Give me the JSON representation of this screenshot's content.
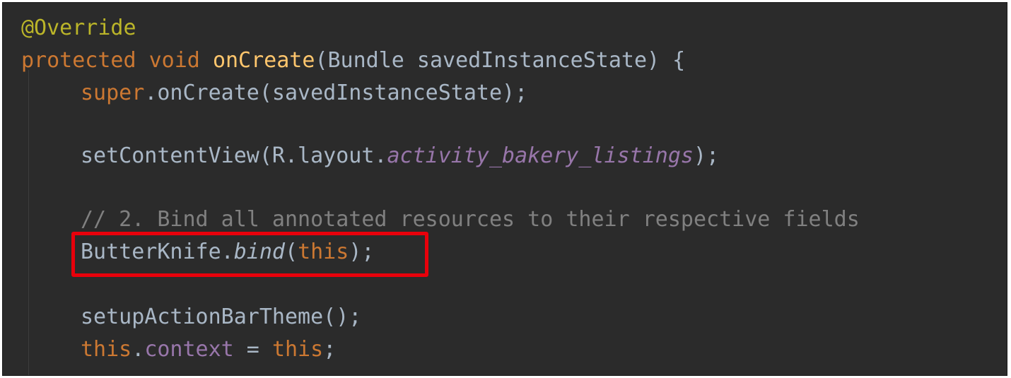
{
  "colors": {
    "background": "#2b2b2b",
    "plain": "#a9b7c6",
    "keyword": "#cc7832",
    "method_decl": "#ffc66d",
    "annotation": "#bbb529",
    "static_field": "#9876aa",
    "comment": "#808080",
    "highlight_border": "#e8000b"
  },
  "code": {
    "l1": {
      "annotation": "@Override"
    },
    "l2": {
      "kw_protected": "protected",
      "kw_void": "void",
      "method": "onCreate",
      "params": "(Bundle savedInstanceState) {"
    },
    "l3": {
      "kw_super": "super",
      "rest": ".onCreate(savedInstanceState);"
    },
    "l4": {
      "pre": "setContentView(R.layout.",
      "static_field": "activity_bakery_listings",
      "post": ");"
    },
    "l5": {
      "comment": "// 2. Bind all annotated resources to their respective fields"
    },
    "l6": {
      "pre": "ButterKnife.",
      "method_italic": "bind",
      "open": "(",
      "kw_this": "this",
      "close": ");"
    },
    "l7": {
      "text": "setupActionBarTheme();"
    },
    "l8": {
      "kw_this_1": "this",
      "dot": ".",
      "field": "context",
      "eq": " = ",
      "kw_this_2": "this",
      "end": ";"
    }
  }
}
